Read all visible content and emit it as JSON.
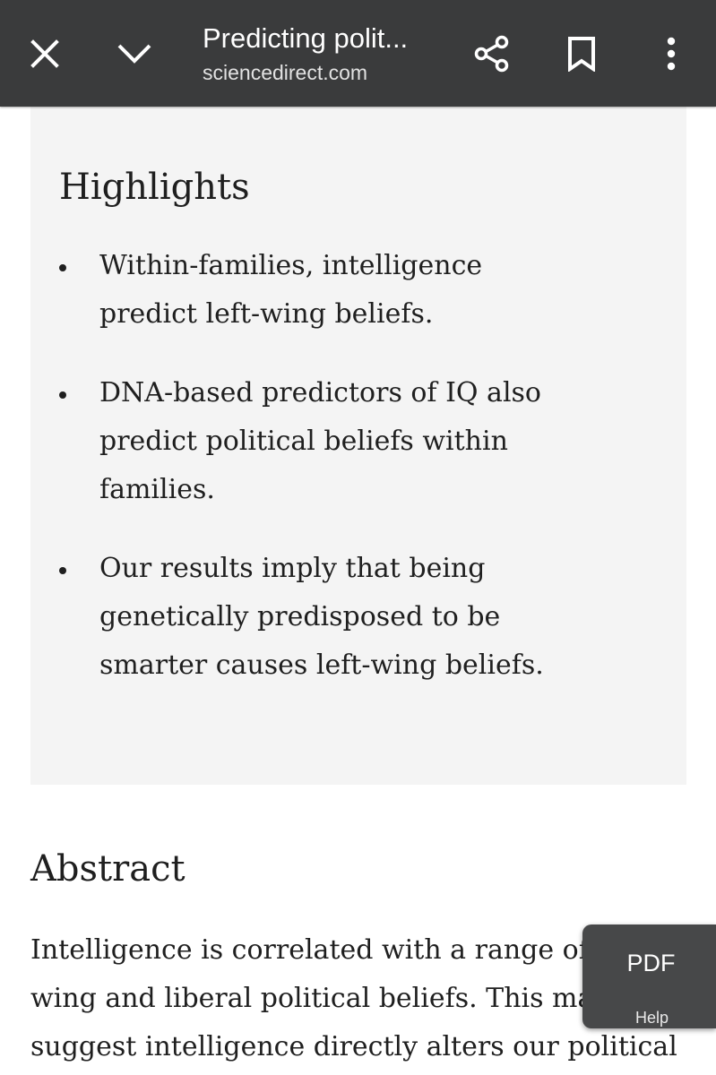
{
  "toolbar": {
    "title": "Predicting polit...",
    "url": "sciencedirect.com",
    "icons": {
      "close": "close-icon",
      "minimize": "chevron-down-icon",
      "share": "share-icon",
      "bookmark": "bookmark-icon",
      "menu": "more-vertical-icon"
    },
    "background": "#3a3b3c"
  },
  "highlights": {
    "heading": "Highlights",
    "items": [
      "Within-families, intelligence predict left-wing beliefs.",
      "DNA-based predictors of IQ also predict political beliefs within families.",
      "Our results imply that being genetically predisposed to be smarter causes left-wing beliefs."
    ],
    "background": "#f4f4f4"
  },
  "abstract": {
    "heading": "Abstract",
    "text": "Intelligence is correlated with a range of left-wing and liberal political beliefs. This may suggest intelligence directly alters our political"
  },
  "pdf_button": {
    "label": "PDF",
    "help": "Help"
  }
}
